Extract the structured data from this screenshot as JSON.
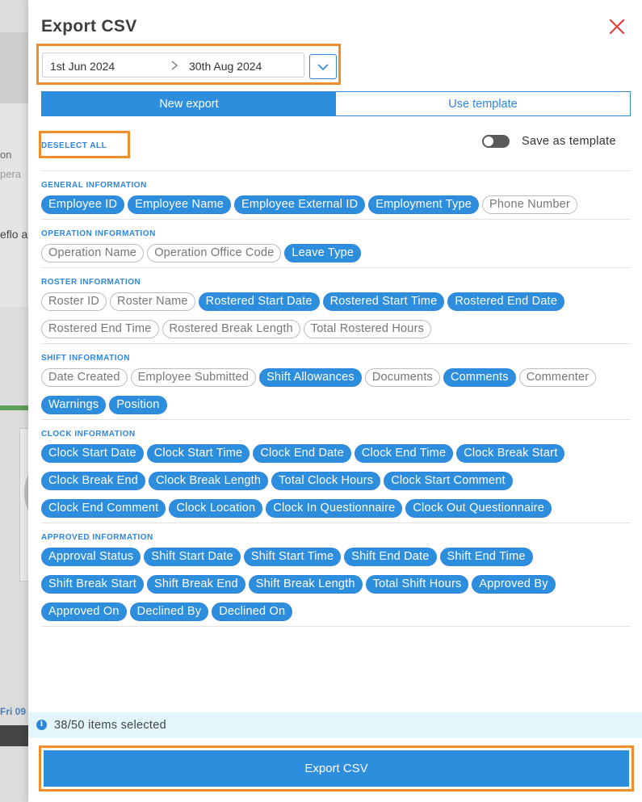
{
  "background": {
    "fragment_1": "on",
    "fragment_2": "pera",
    "fragment_3": "eflo a",
    "fragment_4": "Fri 09"
  },
  "modal": {
    "title": "Export CSV",
    "date_start": "1st Jun 2024",
    "date_end": "30th Aug 2024",
    "tabs": [
      {
        "label": "New export",
        "active": true
      },
      {
        "label": "Use template",
        "active": false
      }
    ],
    "deselect_all": "DESELECT ALL",
    "save_as_template": "Save as template",
    "save_as_template_on": false,
    "sections": [
      {
        "title": "GENERAL INFORMATION",
        "items": [
          {
            "label": "Employee ID",
            "selected": true
          },
          {
            "label": "Employee Name",
            "selected": true
          },
          {
            "label": "Employee External ID",
            "selected": true
          },
          {
            "label": "Employment Type",
            "selected": true
          },
          {
            "label": "Phone Number",
            "selected": false
          }
        ]
      },
      {
        "title": "OPERATION INFORMATION",
        "items": [
          {
            "label": "Operation Name",
            "selected": false
          },
          {
            "label": "Operation Office Code",
            "selected": false
          },
          {
            "label": "Leave Type",
            "selected": true
          }
        ]
      },
      {
        "title": "ROSTER INFORMATION",
        "items": [
          {
            "label": "Roster ID",
            "selected": false
          },
          {
            "label": "Roster Name",
            "selected": false
          },
          {
            "label": "Rostered Start Date",
            "selected": true
          },
          {
            "label": "Rostered Start Time",
            "selected": true
          },
          {
            "label": "Rostered End Date",
            "selected": true
          },
          {
            "label": "Rostered End Time",
            "selected": false
          },
          {
            "label": "Rostered Break Length",
            "selected": false
          },
          {
            "label": "Total Rostered Hours",
            "selected": false
          }
        ]
      },
      {
        "title": "SHIFT INFORMATION",
        "items": [
          {
            "label": "Date Created",
            "selected": false
          },
          {
            "label": "Employee Submitted",
            "selected": false
          },
          {
            "label": "Shift Allowances",
            "selected": true
          },
          {
            "label": "Documents",
            "selected": false
          },
          {
            "label": "Comments",
            "selected": true
          },
          {
            "label": "Commenter",
            "selected": false
          },
          {
            "label": "Warnings",
            "selected": true
          },
          {
            "label": "Position",
            "selected": true
          }
        ]
      },
      {
        "title": "CLOCK INFORMATION",
        "items": [
          {
            "label": "Clock Start Date",
            "selected": true
          },
          {
            "label": "Clock Start Time",
            "selected": true
          },
          {
            "label": "Clock End Date",
            "selected": true
          },
          {
            "label": "Clock End Time",
            "selected": true
          },
          {
            "label": "Clock Break Start",
            "selected": true
          },
          {
            "label": "Clock Break End",
            "selected": true
          },
          {
            "label": "Clock Break Length",
            "selected": true
          },
          {
            "label": "Total Clock Hours",
            "selected": true
          },
          {
            "label": "Clock Start Comment",
            "selected": true
          },
          {
            "label": "Clock End Comment",
            "selected": true
          },
          {
            "label": "Clock Location",
            "selected": true
          },
          {
            "label": "Clock In Questionnaire",
            "selected": true
          },
          {
            "label": "Clock Out Questionnaire",
            "selected": true
          }
        ]
      },
      {
        "title": "APPROVED INFORMATION",
        "items": [
          {
            "label": "Approval Status",
            "selected": true
          },
          {
            "label": "Shift Start Date",
            "selected": true
          },
          {
            "label": "Shift Start Time",
            "selected": true
          },
          {
            "label": "Shift End Date",
            "selected": true
          },
          {
            "label": "Shift End Time",
            "selected": true
          },
          {
            "label": "Shift Break Start",
            "selected": true
          },
          {
            "label": "Shift Break End",
            "selected": true
          },
          {
            "label": "Shift Break Length",
            "selected": true
          },
          {
            "label": "Total Shift Hours",
            "selected": true
          },
          {
            "label": "Approved By",
            "selected": true
          },
          {
            "label": "Approved On",
            "selected": true
          },
          {
            "label": "Declined By",
            "selected": true
          },
          {
            "label": "Declined On",
            "selected": true
          }
        ]
      }
    ],
    "selected_summary": "38/50 items selected",
    "export_button": "Export CSV"
  },
  "colors": {
    "accent": "#2e8ede",
    "highlight": "#f28c28",
    "close": "#e04040",
    "info_bg": "#e2f6fb"
  },
  "icons": [
    "close-icon",
    "chevron-right-icon",
    "chevron-down-icon",
    "info-icon"
  ]
}
